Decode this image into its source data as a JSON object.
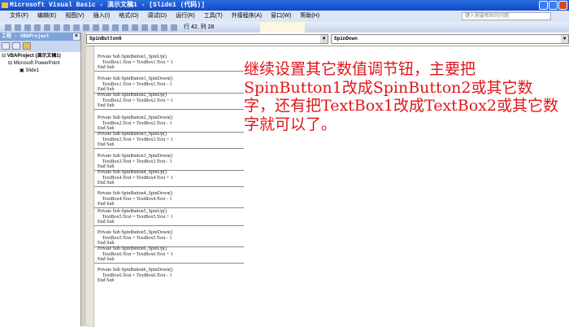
{
  "window": {
    "title": "Microsoft Visual Basic - 演示文稿1 - [Slide1 (代码)]"
  },
  "menu": [
    "文件(F)",
    "编辑(E)",
    "视图(V)",
    "插入(I)",
    "格式(O)",
    "调试(D)",
    "运行(R)",
    "工具(T)",
    "外接程序(A)",
    "窗口(W)",
    "帮助(H)"
  ],
  "help_placeholder": "键入需要帮助的问题",
  "toolbar": {
    "position": "行 42, 列 28"
  },
  "project": {
    "title": "工程 - VBAProject",
    "tree": [
      "VBAProject (演示文稿1)",
      "Microsoft PowerPoint",
      "Slide1"
    ]
  },
  "code": {
    "object_combo": "SpinButton6",
    "proc_combo": "SpinDown",
    "blocks": [
      [
        "Private Sub SpinButton1_SpinUp()",
        "    TextBox1.Text = TextBox1.Text + 1",
        "End Sub"
      ],
      [
        "Private Sub SpinButton1_SpinDown()",
        "    TextBox1.Text = TextBox1.Text - 1",
        "End Sub"
      ],
      [
        "Private Sub SpinButton2_SpinUp()",
        "    TextBox2.Text = TextBox2.Text + 1",
        "End Sub"
      ],
      [
        "Private Sub SpinButton2_SpinDown()",
        "    TextBox2.Text = TextBox2.Text - 1",
        "End Sub"
      ],
      [
        "Private Sub SpinButton3_SpinUp()",
        "    TextBox3.Text = TextBox3.Text + 1",
        "End Sub"
      ],
      [
        "Private Sub SpinButton3_SpinDown()",
        "    TextBox3.Text = TextBox3.Text - 1",
        "End Sub"
      ],
      [
        "Private Sub SpinButton4_SpinUp()",
        "    TextBox4.Text = TextBox4.Text + 1",
        "End Sub"
      ],
      [
        "Private Sub SpinButton4_SpinDown()",
        "    TextBox4.Text = TextBox4.Text - 1",
        "End Sub"
      ],
      [
        "Private Sub SpinButton5_SpinUp()",
        "    TextBox5.Text = TextBox5.Text + 1",
        "End Sub"
      ],
      [
        "Private Sub SpinButton5_SpinDown()",
        "    TextBox5.Text = TextBox5.Text - 1",
        "End Sub"
      ],
      [
        "Private Sub SpinButton6_SpinUp()",
        "    TextBox6.Text = TextBox6.Text + 1",
        "End Sub"
      ],
      [
        "Private Sub SpinButton6_SpinDown()",
        "    TextBox6.Text = TextBox6.Text - 1",
        "End Sub"
      ]
    ]
  },
  "annotation": "继续设置其它数值调节钮，主要把SpinButton1改成SpinButton2或其它数字，还有把TextBox1改成TextBox2或其它数字就可以了。",
  "colors": {
    "annotation": "#e0161a",
    "titlebar": "#1a5ad8"
  }
}
